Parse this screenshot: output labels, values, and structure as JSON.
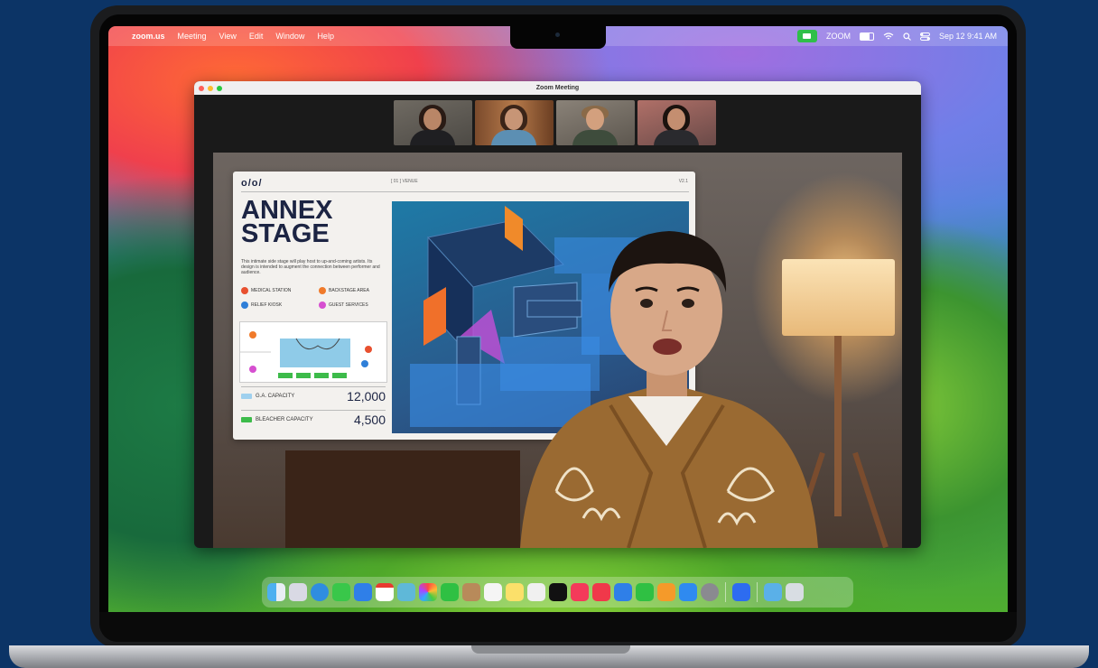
{
  "menubar": {
    "apple_glyph": "",
    "app": "zoom.us",
    "items": [
      "Meeting",
      "View",
      "Edit",
      "Window",
      "Help"
    ],
    "status_app": "ZOOM",
    "datetime": "Sep 12  9:41 AM"
  },
  "window": {
    "title": "Zoom Meeting"
  },
  "slide": {
    "logo": "ο/ο/",
    "header_text": "[ 01 ] VENUE",
    "version": "V2.1",
    "title_line1": "ANNEX",
    "title_line2": "STAGE",
    "description": "This intimate side stage will play host to up-and-coming artists. Its design is intended to augment the connection between performer and audience.",
    "legend": [
      {
        "label": "MEDICAL STATION",
        "color": "#e8502f"
      },
      {
        "label": "BACKSTAGE AREA",
        "color": "#f07a2a"
      },
      {
        "label": "RELIEF KIOSK",
        "color": "#2f7fd8"
      },
      {
        "label": "GUEST SERVICES",
        "color": "#d64fd0"
      }
    ],
    "stats": [
      {
        "label": "G.A. CAPACITY",
        "value": "12,000",
        "color": "#9fd0ee"
      },
      {
        "label": "BLEACHER CAPACITY",
        "value": "4,500",
        "color": "#3dbb4a"
      }
    ]
  },
  "colors": {
    "dot_red": "#fe5f57",
    "dot_yellow": "#febc2e",
    "dot_green": "#28c840"
  }
}
